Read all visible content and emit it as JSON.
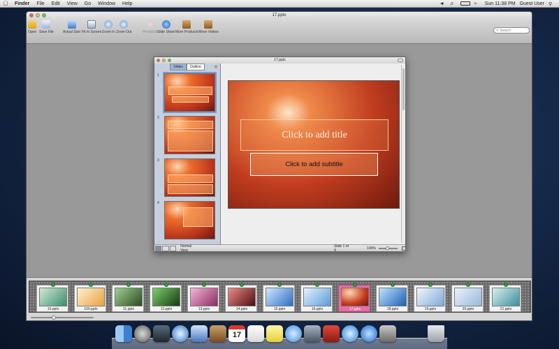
{
  "menubar": {
    "app": "Finder",
    "items": [
      "File",
      "Edit",
      "View",
      "Go",
      "Window",
      "Help"
    ],
    "clock": "Sun 11:38 PM",
    "user": "Guest User"
  },
  "window": {
    "title": "17.pptx",
    "toolbar": [
      {
        "label": "Open",
        "icon": "folder-icon"
      },
      {
        "label": "Save File",
        "icon": "save-file-icon"
      },
      {
        "label": "Actual Size",
        "icon": "actual-size-icon"
      },
      {
        "label": "Fit to Screen",
        "icon": "fit-to-screen-icon"
      },
      {
        "label": "Zoom In",
        "icon": "zoom-in-icon"
      },
      {
        "label": "Zoom Out",
        "icon": "zoom-out-icon"
      },
      {
        "label": "PhotoEdit",
        "icon": "photo-edit-icon"
      },
      {
        "label": "Slide Show",
        "icon": "play-icon"
      },
      {
        "label": "More Products",
        "icon": "box-icon"
      },
      {
        "label": "Move Videos",
        "icon": "box-icon"
      }
    ],
    "search_placeholder": "Search"
  },
  "document": {
    "title": "17.pptx",
    "tabs": [
      "Slides",
      "Outline"
    ],
    "thumbnails": [
      "1",
      "2",
      "3",
      "4"
    ],
    "slide": {
      "title_placeholder": "Click to add title",
      "subtitle_placeholder": "Click to add subtitle"
    },
    "status": {
      "view": "Normal View",
      "slide": "Slide 1 of 4",
      "zoom": "100%"
    }
  },
  "filmstrip": {
    "items": [
      "10.pptx",
      "100.pptx",
      "11.pptx",
      "12.pptx",
      "13.pptx",
      "14.pptx",
      "15.pptx",
      "16.pptx",
      "17.pptx",
      "18.pptx",
      "19.pptx",
      "20.pptx",
      "21.pptx"
    ],
    "selected": "17.pptx"
  },
  "dock": {
    "icons": [
      "finder-icon",
      "launchpad-icon",
      "mission-control-icon",
      "safari-icon",
      "preview-icon",
      "contacts-icon",
      "calendar-icon",
      "reminders-icon",
      "stickies-icon",
      "messages-icon",
      "facetime-icon",
      "photo-booth-icon",
      "itunes-icon",
      "app-store-icon",
      "system-preferences-icon",
      "trash-icon"
    ],
    "calendar_day": "17"
  }
}
